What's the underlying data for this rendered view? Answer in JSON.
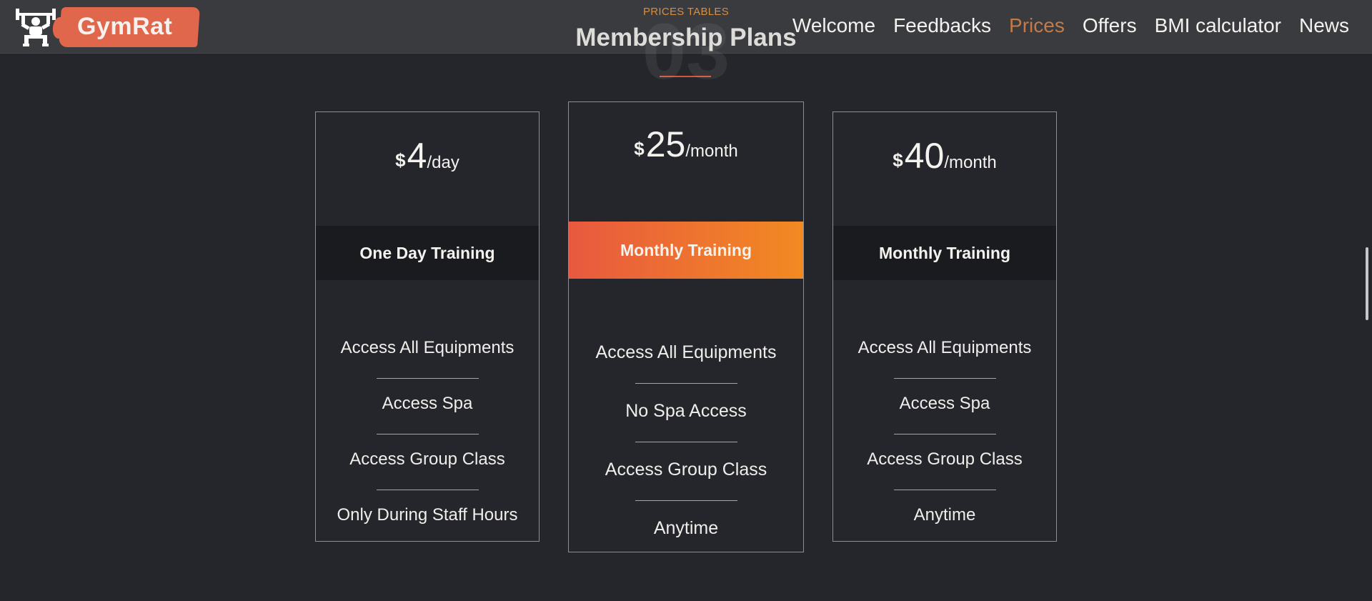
{
  "navbar": {
    "brand": "GymRat",
    "links": [
      {
        "label": "Welcome"
      },
      {
        "label": "Feedbacks"
      },
      {
        "label": "Prices"
      },
      {
        "label": "Offers"
      },
      {
        "label": "BMI calculator"
      },
      {
        "label": "News"
      }
    ],
    "active_link": "Prices",
    "active_color": "#c27b48"
  },
  "section": {
    "eyebrow": "PRICES TABLES",
    "number": "03",
    "title": "Membership Plans"
  },
  "plans": [
    {
      "currency": "$",
      "amount": "4",
      "period": "/day",
      "name": "One Day Training",
      "featured": false,
      "features": [
        "Access All Equipments",
        "Access Spa",
        "Access Group Class",
        "Only During Staff Hours"
      ]
    },
    {
      "currency": "$",
      "amount": "25",
      "period": "/month",
      "name": "Monthly Training",
      "featured": true,
      "features": [
        "Access All Equipments",
        "No Spa Access",
        "Access Group Class",
        "Anytime"
      ]
    },
    {
      "currency": "$",
      "amount": "40",
      "period": "/month",
      "name": "Monthly Training",
      "featured": false,
      "features": [
        "Access All Equipments",
        "Access Spa",
        "Access Group Class",
        "Anytime"
      ]
    }
  ],
  "colors": {
    "background": "#25262b",
    "navbar": "#3a3b3f",
    "brand_brush": "#e0664c",
    "accent_orange": "#d98d3e",
    "featured_gradient": [
      "#e8593f",
      "#f28a22"
    ],
    "plan_band": "#1a1b1f"
  },
  "icons": {
    "logo": "weightlifter-icon"
  }
}
